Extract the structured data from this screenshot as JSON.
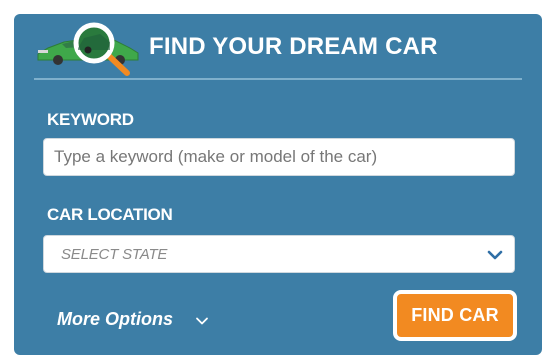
{
  "header": {
    "title": "FIND YOUR DREAM CAR",
    "logo_icon": "car-magnifier-icon"
  },
  "keyword": {
    "label": "KEYWORD",
    "value": "",
    "placeholder": "Type a keyword (make or model of the car)"
  },
  "location": {
    "label": "CAR LOCATION",
    "selected": "SELECT STATE",
    "arrow_icon": "chevron-down-icon"
  },
  "more_options": {
    "label": "More Options",
    "icon": "chevron-down-icon"
  },
  "find_button": {
    "label": "FIND CAR"
  },
  "colors": {
    "panel": "#3d7ea6",
    "divider": "#7fb0cc",
    "button": "#f28a21",
    "select_arrow": "#2f6fa6",
    "car_body": "#3fa84a",
    "magnifier_handle": "#f28a21"
  }
}
